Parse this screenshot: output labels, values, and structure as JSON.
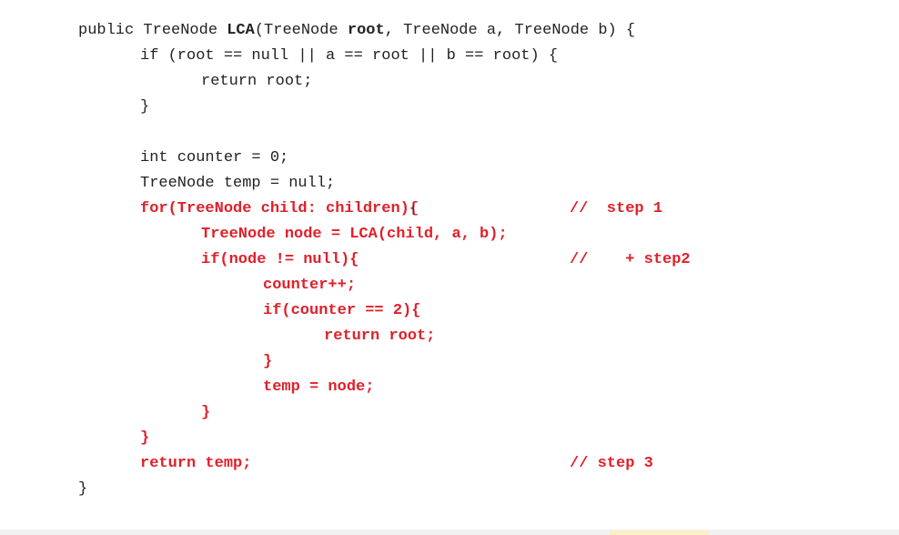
{
  "lines": {
    "l1_pre": "public TreeNode ",
    "l1_lca": "LCA",
    "l1_mid": "(TreeNode ",
    "l1_root": "root",
    "l1_post": ", TreeNode a, TreeNode b) {",
    "l2": "if (root == null || a == root || b == root) {",
    "l3": "return root;",
    "l4": "}",
    "l5": "int counter = 0;",
    "l6": "TreeNode temp = null;",
    "l7": "for(TreeNode child: children){",
    "l8": "TreeNode node = LCA(child, a, b);",
    "l9": "if(node != null){",
    "l10": "counter++;",
    "l11": "if(counter == 2){",
    "l12": "return root;",
    "l13": "}",
    "l14": "temp = node;",
    "l15": "}",
    "l16": "}",
    "l17": "return temp;",
    "l18": "}"
  },
  "comments": {
    "c1": "//  step 1",
    "c2": "//    + step2",
    "c3": "// step 3"
  },
  "cursor_glyph": "I",
  "colors": {
    "code_black": "#222222",
    "code_red": "#e0202a"
  }
}
